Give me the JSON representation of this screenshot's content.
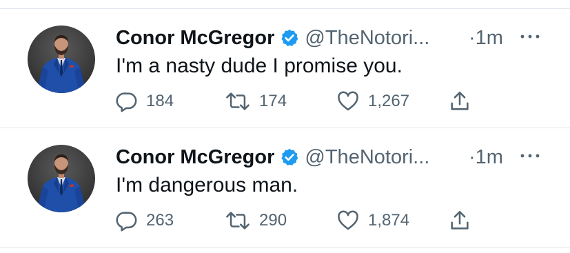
{
  "colors": {
    "verified_blue": "#1d9bf0",
    "secondary_text": "#536471",
    "primary_text": "#0f1419",
    "divider": "#e1e8ed"
  },
  "tweets": [
    {
      "display_name": "Conor McGregor",
      "verified": true,
      "handle": "@TheNotori...",
      "time": "·1m",
      "text": "I'm a nasty dude I promise you.",
      "reply_count": "184",
      "retweet_count": "174",
      "like_count": "1,267",
      "icons": [
        "reply-icon",
        "retweet-icon",
        "like-icon",
        "share-icon",
        "more-icon",
        "verified-icon"
      ]
    },
    {
      "display_name": "Conor McGregor",
      "verified": true,
      "handle": "@TheNotori...",
      "time": "·1m",
      "text": "I'm dangerous man.",
      "reply_count": "263",
      "retweet_count": "290",
      "like_count": "1,874",
      "icons": [
        "reply-icon",
        "retweet-icon",
        "like-icon",
        "share-icon",
        "more-icon",
        "verified-icon"
      ]
    }
  ]
}
